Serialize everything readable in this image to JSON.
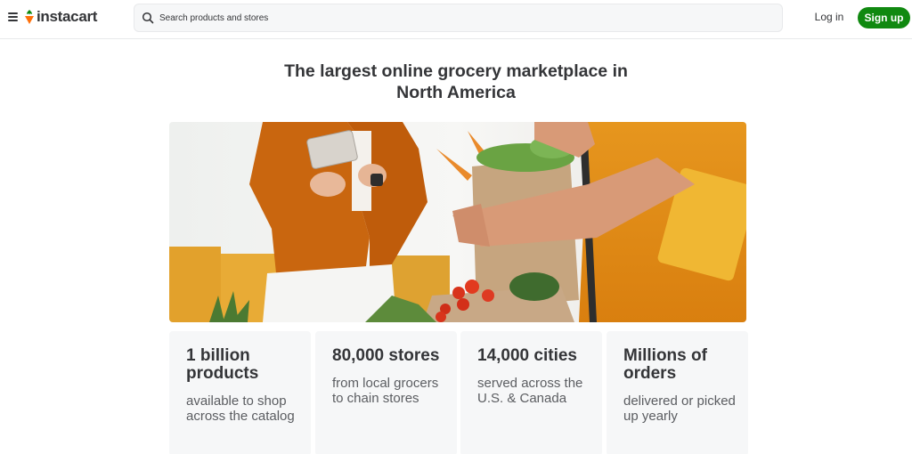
{
  "brand": {
    "name": "instacart",
    "logo_icon": "carrot-logo-icon",
    "accent": "#108910",
    "logo_orange": "#ff7009"
  },
  "header": {
    "menu_icon": "hamburger-menu-icon",
    "search": {
      "placeholder": "Search products and stores",
      "icon": "search-icon"
    },
    "login_label": "Log in",
    "signup_label": "Sign up"
  },
  "hero": {
    "headline": "The largest online grocery marketplace in North America"
  },
  "stats": [
    {
      "title": "1 billion products",
      "desc": "available to shop across the catalog"
    },
    {
      "title": "80,000 stores",
      "desc": "from local grocers to chain stores"
    },
    {
      "title": "14,000 cities",
      "desc": "served across the U.S. & Canada"
    },
    {
      "title": "Millions of orders",
      "desc": "delivered or picked up yearly"
    }
  ]
}
